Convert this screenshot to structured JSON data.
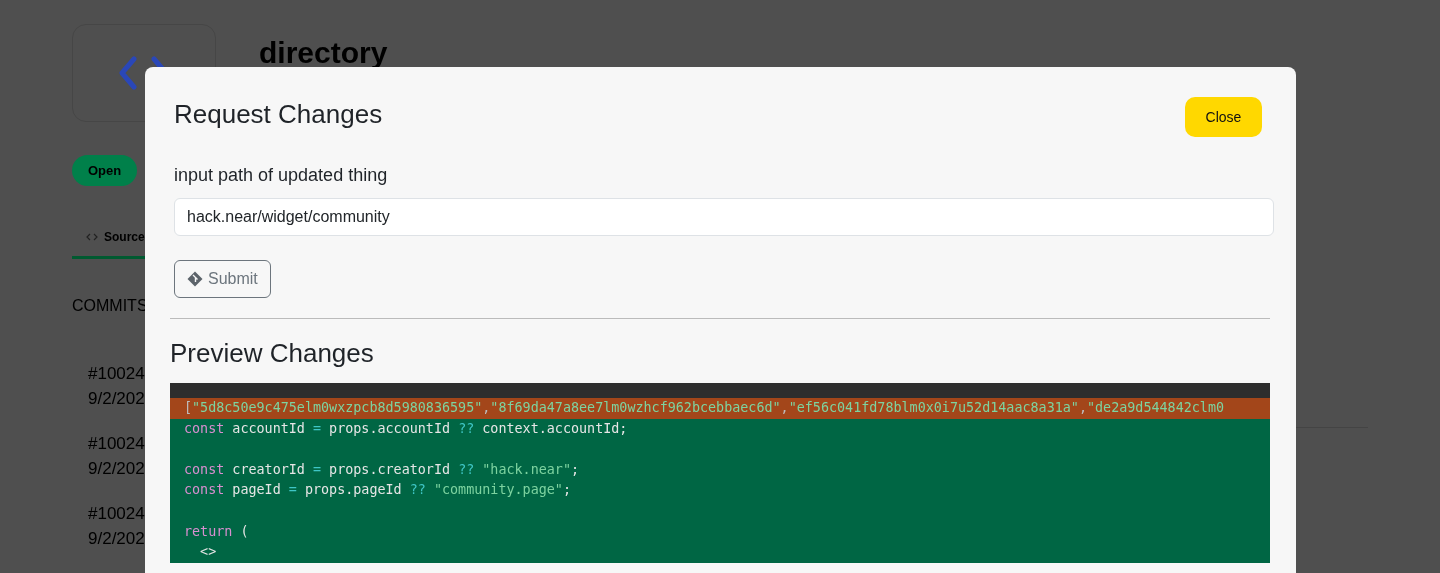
{
  "page": {
    "title": "directory",
    "status": "Open",
    "tabs": [
      {
        "label": "Source",
        "selected": true
      }
    ],
    "section": "COMMITS",
    "commits": [
      {
        "id": "#10024",
        "date": "9/2/202"
      },
      {
        "id": "#10024",
        "date": "9/2/202"
      },
      {
        "id": "#10024",
        "date": "9/2/202"
      }
    ]
  },
  "modal": {
    "title": "Request Changes",
    "close": "Close",
    "field_label": "input path of updated thing",
    "field_value": "hack.near/widget/community",
    "submit": "Submit",
    "preview_title": "Preview Changes",
    "code": [
      {
        "kind": "removed",
        "segments": [
          {
            "text": "[",
            "kind": "punct"
          },
          {
            "text": "\"5d8c50e9c475elm0wxzpcb8d5980836595\"",
            "kind": "string"
          },
          {
            "text": ",",
            "kind": "punct"
          },
          {
            "text": "\"8f69da47a8ee7lm0wzhcf962bcebbaec6d\"",
            "kind": "string"
          },
          {
            "text": ",",
            "kind": "punct"
          },
          {
            "text": "\"ef56c041fd78blm0x0i7u52d14aac8a31a\"",
            "kind": "string"
          },
          {
            "text": ",",
            "kind": "punct"
          },
          {
            "text": "\"de2a9d544842clm0",
            "kind": "string"
          }
        ]
      },
      {
        "kind": "added",
        "segments": [
          {
            "text": "const",
            "kind": "keyword"
          },
          {
            "text": " accountId ",
            "kind": "plain"
          },
          {
            "text": "=",
            "kind": "operator"
          },
          {
            "text": " props.accountId ",
            "kind": "plain"
          },
          {
            "text": "??",
            "kind": "operator"
          },
          {
            "text": " context.accountId;",
            "kind": "plain"
          }
        ]
      },
      {
        "kind": "added"
      },
      {
        "kind": "added",
        "segments": [
          {
            "text": "const",
            "kind": "keyword"
          },
          {
            "text": " creatorId ",
            "kind": "plain"
          },
          {
            "text": "=",
            "kind": "operator"
          },
          {
            "text": " props.creatorId ",
            "kind": "plain"
          },
          {
            "text": "??",
            "kind": "operator"
          },
          {
            "text": " \"hack.near\"",
            "kind": "string"
          },
          {
            "text": ";",
            "kind": "plain"
          }
        ]
      },
      {
        "kind": "added",
        "segments": [
          {
            "text": "const",
            "kind": "keyword"
          },
          {
            "text": " pageId ",
            "kind": "plain"
          },
          {
            "text": "=",
            "kind": "operator"
          },
          {
            "text": " props.pageId ",
            "kind": "plain"
          },
          {
            "text": "??",
            "kind": "operator"
          },
          {
            "text": " \"community.page\"",
            "kind": "string"
          },
          {
            "text": ";",
            "kind": "plain"
          }
        ]
      },
      {
        "kind": "added"
      },
      {
        "kind": "added",
        "segments": [
          {
            "text": "return",
            "kind": "keyword"
          },
          {
            "text": " (",
            "kind": "plain"
          }
        ]
      },
      {
        "kind": "added",
        "segments": [
          {
            "text": "  <>",
            "kind": "plain"
          }
        ]
      }
    ]
  }
}
